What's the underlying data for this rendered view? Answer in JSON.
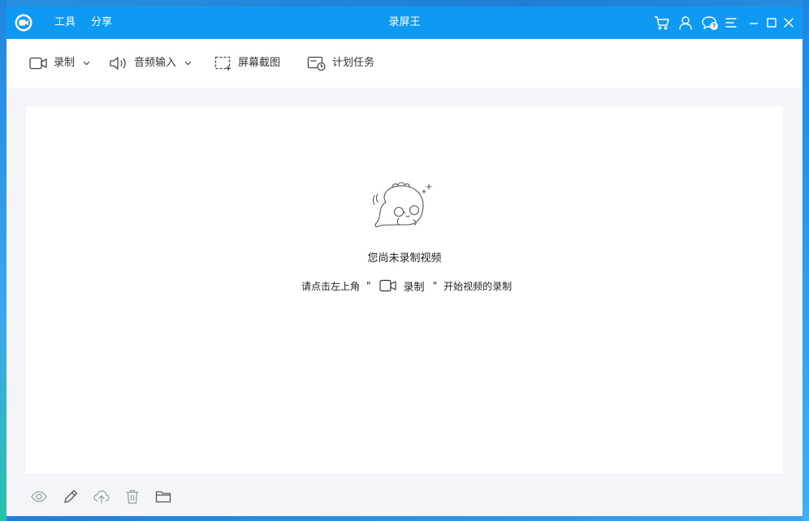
{
  "app": {
    "title": "录屏王",
    "menu": {
      "tools": "工具",
      "share": "分享"
    },
    "accent": "#0e9af3",
    "chat_badge": "7"
  },
  "toolbar": {
    "record": "录制",
    "audio_input": "音频输入",
    "screenshot": "屏幕截图",
    "scheduled_task": "计划任务"
  },
  "empty_state": {
    "title": "您尚未录制视频",
    "hint_prefix": "请点击左上角",
    "quote_open": "\"",
    "record_label": "录制",
    "quote_close": "\"",
    "hint_suffix": "开始视频的录制"
  },
  "icons": {
    "titlebar": [
      "cart-icon",
      "user-icon",
      "chat-icon",
      "menu-icon",
      "minimize-icon",
      "maximize-icon",
      "close-icon"
    ],
    "bottombar": [
      "eye-icon",
      "pencil-icon",
      "cloud-upload-icon",
      "trash-icon",
      "folder-icon"
    ]
  }
}
